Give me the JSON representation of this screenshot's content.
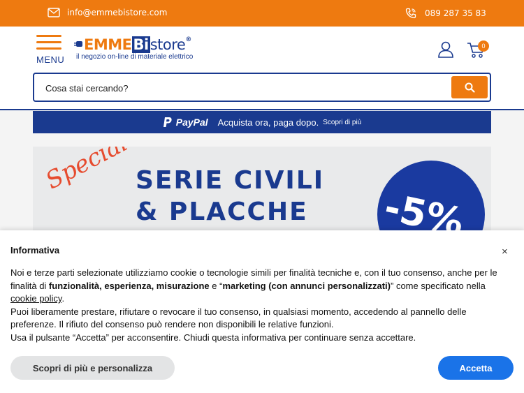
{
  "topbar": {
    "email": "info@emmebistore.com",
    "phone": "089 287 35 83",
    "colors": {
      "background": "#ee7a10",
      "text": "#ffffff"
    }
  },
  "header": {
    "menu_label": "MENU",
    "logo": {
      "brand_part1": "EMME",
      "brand_part2": "Bi",
      "brand_part3": "store",
      "registered": "®",
      "tagline": "il negozio on-line di materiale elettrico"
    },
    "cart_count": "0",
    "search_placeholder": "Cosa stai cercando?",
    "icons": [
      "hamburger-icon",
      "user-icon",
      "cart-icon",
      "search-icon"
    ],
    "colors": {
      "accent": "#ee7a10",
      "brand": "#1a3a8f"
    }
  },
  "paypal_banner": {
    "brand": "PayPal",
    "text": "Acquista ora, paga dopo.",
    "link": "Scopri di più"
  },
  "promo": {
    "script_text": "Speciale!",
    "line1": "SERIE CIVILI",
    "line2": "& PLACCHE",
    "discount": "-5%"
  },
  "cookie": {
    "title": "Informativa",
    "close": "×",
    "p1_a": "Noi e terze parti selezionate utilizziamo cookie o tecnologie simili per finalità tecniche e, con il tuo consenso, anche per le finalità di ",
    "p1_bold1": "funzionalità, esperienza, misurazione",
    "p1_and": " e “",
    "p1_bold2": "marketing (con annunci personalizzati)",
    "p1_b": "” come specificato nella ",
    "p1_link": "cookie policy",
    "p1_end": ".",
    "p2": "Puoi liberamente prestare, rifiutare o revocare il tuo consenso, in qualsiasi momento, accedendo al pannello delle preferenze. Il rifiuto del consenso può rendere non disponibili le relative funzioni.",
    "p3": "Usa il pulsante “Accetta” per acconsentire. Chiudi questa informativa per continuare senza accettare.",
    "btn_more": "Scopri di più e personalizza",
    "btn_accept": "Accetta",
    "colors": {
      "accept": "#1a73e8"
    }
  }
}
